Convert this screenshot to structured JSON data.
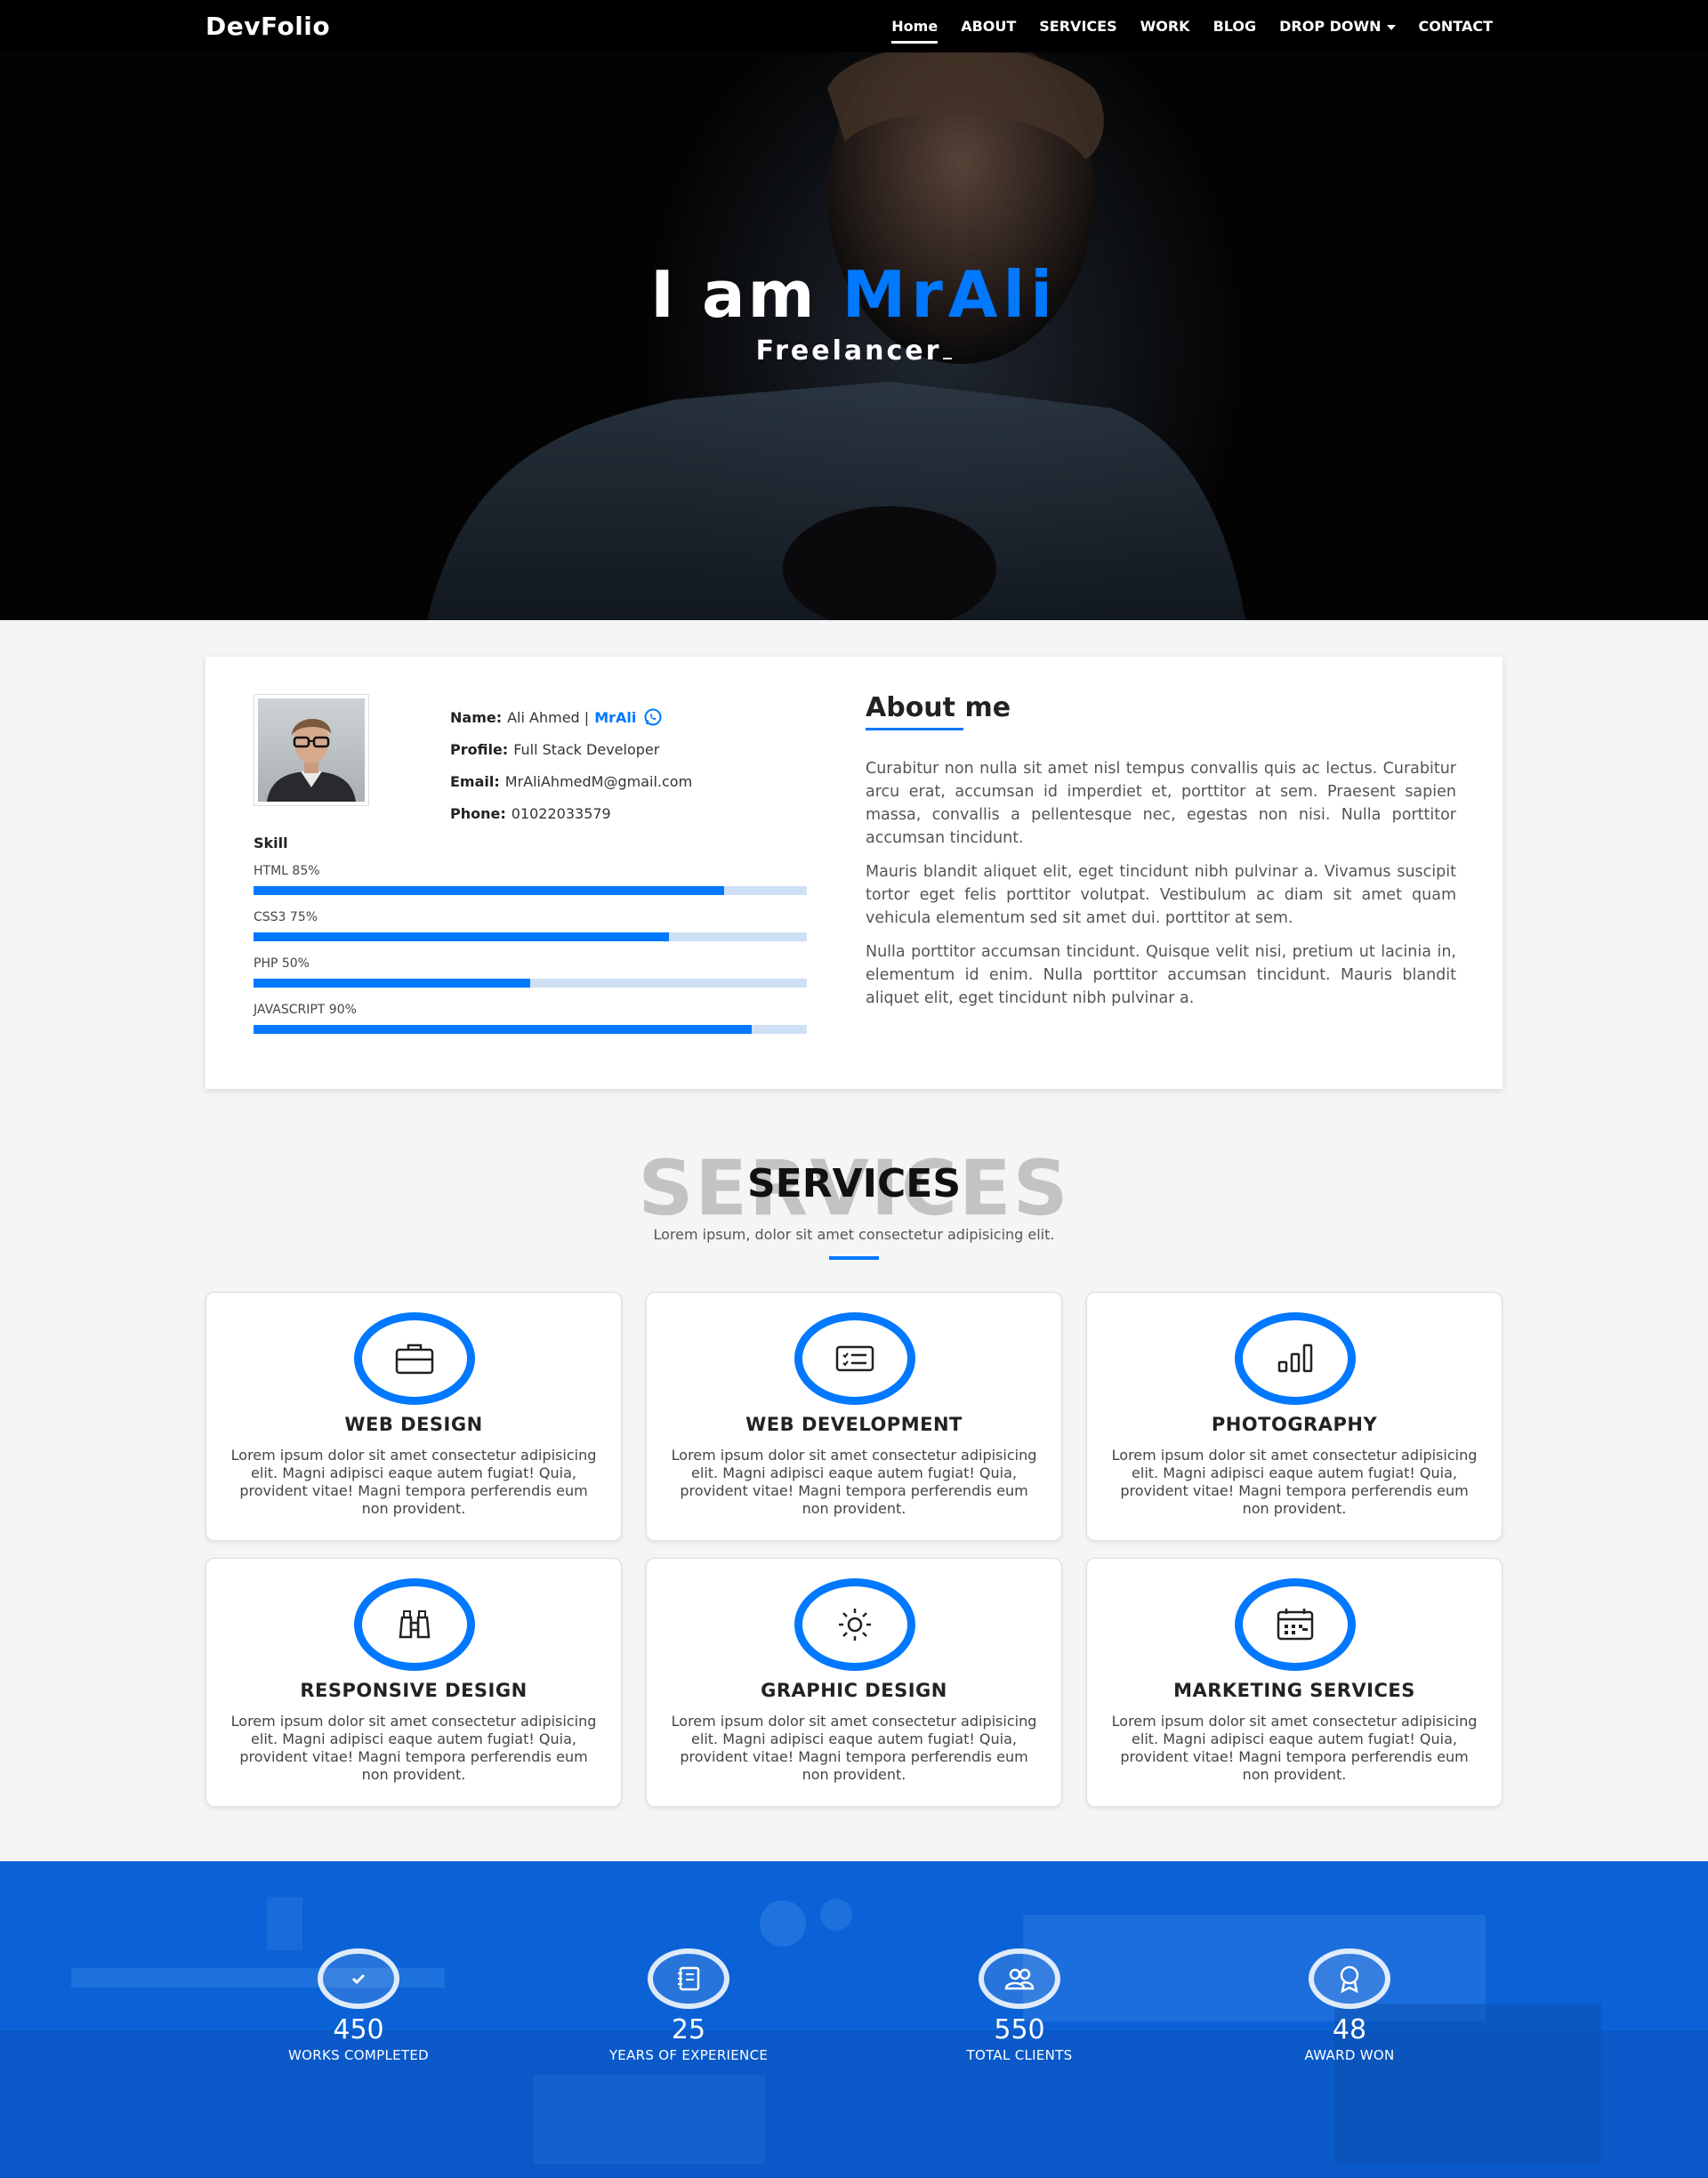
{
  "nav": {
    "brand": "DevFolio",
    "items": [
      {
        "label": "Home",
        "active": true
      },
      {
        "label": "ABOUT"
      },
      {
        "label": "SERVICES"
      },
      {
        "label": "WORK"
      },
      {
        "label": "BLOG"
      },
      {
        "label": "DROP DOWN",
        "dropdown": true
      },
      {
        "label": "CONTACT"
      }
    ]
  },
  "hero": {
    "title_prefix": "I am",
    "title_name": "MrAli",
    "subtitle": "Freelancer"
  },
  "about": {
    "name_label": "Name:",
    "name_value": "Ali Ahmed |",
    "name_link": "MrAli",
    "profile_label": "Profile:",
    "profile_value": "Full Stack Developer",
    "email_label": "Email:",
    "email_value": "MrAliAhmedM@gmail.com",
    "phone_label": "Phone:",
    "phone_value": "01022033579",
    "skill_title": "Skill",
    "skills": [
      {
        "label": "HTML 85%",
        "percent": 85
      },
      {
        "label": "CSS3 75%",
        "percent": 75
      },
      {
        "label": "PHP 50%",
        "percent": 50
      },
      {
        "label": "JAVASCRIPT 90%",
        "percent": 90
      }
    ],
    "heading": "About me",
    "paragraphs": [
      "Curabitur non nulla sit amet nisl tempus convallis quis ac lectus. Curabitur arcu erat, accumsan id imperdiet et, porttitor at sem. Praesent sapien massa, convallis a pellentesque nec, egestas non nisi. Nulla porttitor accumsan tincidunt.",
      "Mauris blandit aliquet elit, eget tincidunt nibh pulvinar a. Vivamus suscipit tortor eget felis porttitor volutpat. Vestibulum ac diam sit amet quam vehicula elementum sed sit amet dui. porttitor at sem.",
      "Nulla porttitor accumsan tincidunt. Quisque velit nisi, pretium ut lacinia in, elementum id enim. Nulla porttitor accumsan tincidunt. Mauris blandit aliquet elit, eget tincidunt nibh pulvinar a."
    ]
  },
  "services": {
    "ghost": "SERVICES",
    "title": "SERVICES",
    "subtitle": "Lorem ipsum, dolor sit amet consectetur adipisicing elit.",
    "items": [
      {
        "name": "WEB DESIGN",
        "icon": "briefcase-icon",
        "desc": "Lorem ipsum dolor sit amet consectetur adipisicing elit. Magni adipisci eaque autem fugiat! Quia, provident vitae! Magni tempora perferendis eum non provident."
      },
      {
        "name": "WEB DEVELOPMENT",
        "icon": "card-list-icon",
        "desc": "Lorem ipsum dolor sit amet consectetur adipisicing elit. Magni adipisci eaque autem fugiat! Quia, provident vitae! Magni tempora perferendis eum non provident."
      },
      {
        "name": "PHOTOGRAPHY",
        "icon": "bar-chart-icon",
        "desc": "Lorem ipsum dolor sit amet consectetur adipisicing elit. Magni adipisci eaque autem fugiat! Quia, provident vitae! Magni tempora perferendis eum non provident."
      },
      {
        "name": "RESPONSIVE DESIGN",
        "icon": "binoculars-icon",
        "desc": "Lorem ipsum dolor sit amet consectetur adipisicing elit. Magni adipisci eaque autem fugiat! Quia, provident vitae! Magni tempora perferendis eum non provident."
      },
      {
        "name": "GRAPHIC DESIGN",
        "icon": "sun-icon",
        "desc": "Lorem ipsum dolor sit amet consectetur adipisicing elit. Magni adipisci eaque autem fugiat! Quia, provident vitae! Magni tempora perferendis eum non provident."
      },
      {
        "name": "MARKETING SERVICES",
        "icon": "calendar-icon",
        "desc": "Lorem ipsum dolor sit amet consectetur adipisicing elit. Magni adipisci eaque autem fugiat! Quia, provident vitae! Magni tempora perferendis eum non provident."
      }
    ]
  },
  "counters": [
    {
      "value": "450",
      "label": "WORKS COMPLETED",
      "icon": "check-icon"
    },
    {
      "value": "25",
      "label": "YEARS OF EXPERIENCE",
      "icon": "journal-icon"
    },
    {
      "value": "550",
      "label": "TOTAL CLIENTS",
      "icon": "people-icon"
    },
    {
      "value": "48",
      "label": "AWARD WON",
      "icon": "award-icon"
    }
  ],
  "colors": {
    "accent": "#0078ff",
    "nav_bg": "#000000",
    "page_bg": "#f5f5f5",
    "counter_bg": "#0a5fd0"
  }
}
